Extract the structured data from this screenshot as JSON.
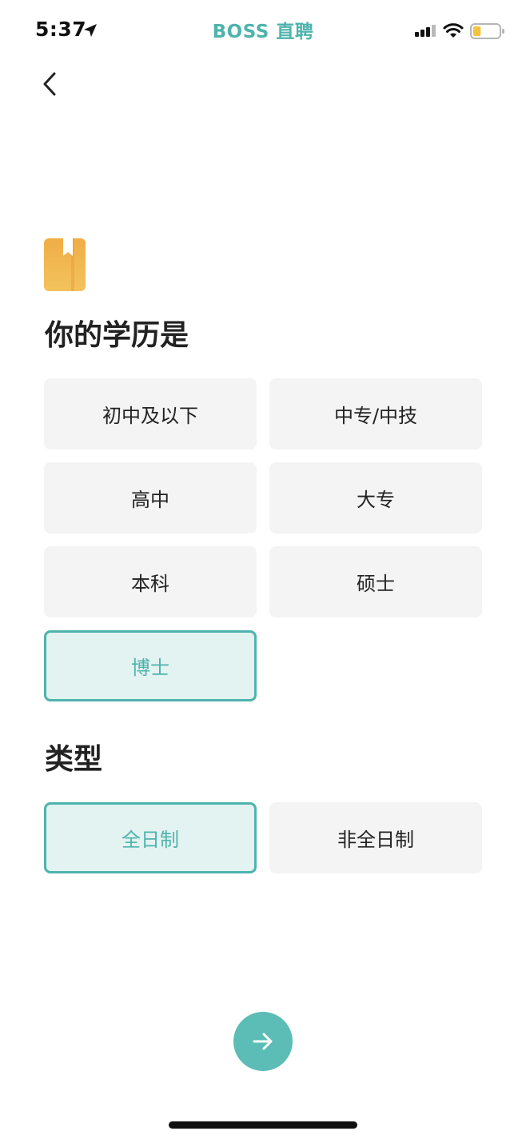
{
  "status_bar": {
    "time": "5:37",
    "app_title": "BOSS 直聘",
    "icons": [
      "location-arrow-icon",
      "cellular-signal-icon",
      "wifi-icon",
      "battery-icon"
    ]
  },
  "navigation": {
    "back_icon": "chevron-left-icon"
  },
  "education": {
    "icon": "book-icon",
    "heading": "你的学历是",
    "options": [
      {
        "label": "初中及以下",
        "selected": false
      },
      {
        "label": "中专/中技",
        "selected": false
      },
      {
        "label": "高中",
        "selected": false
      },
      {
        "label": "大专",
        "selected": false
      },
      {
        "label": "本科",
        "selected": false
      },
      {
        "label": "硕士",
        "selected": false
      },
      {
        "label": "博士",
        "selected": true
      }
    ]
  },
  "study_type": {
    "heading": "类型",
    "options": [
      {
        "label": "全日制",
        "selected": true
      },
      {
        "label": "非全日制",
        "selected": false
      }
    ]
  },
  "next_button": {
    "icon": "arrow-right-icon"
  },
  "colors": {
    "accent": "#4eb3ad",
    "accent_button": "#5bbdb6",
    "selected_background": "#e3f3f1",
    "option_background": "#f4f4f4",
    "book_icon": "#f0b24f",
    "battery_level": "#f5c242"
  },
  "battery_level_fraction": 0.3
}
